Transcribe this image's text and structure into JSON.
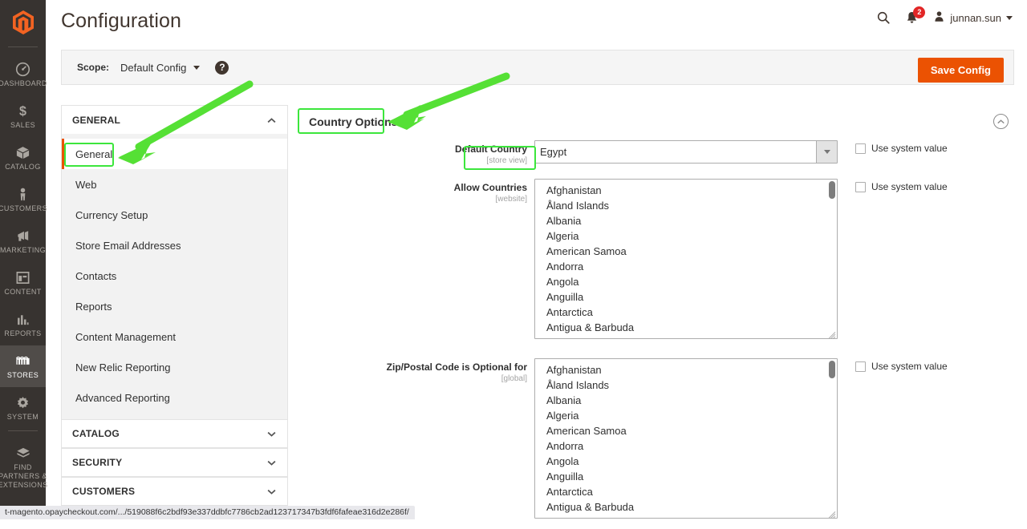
{
  "app": {
    "page_title": "Configuration",
    "logo_icon": "magento-logo-icon"
  },
  "rail": {
    "items": [
      {
        "label": "DASHBOARD",
        "icon": "dashboard-icon",
        "active": false
      },
      {
        "label": "SALES",
        "icon": "dollar-icon",
        "active": false
      },
      {
        "label": "CATALOG",
        "icon": "box-icon",
        "active": false
      },
      {
        "label": "CUSTOMERS",
        "icon": "person-icon",
        "active": false
      },
      {
        "label": "MARKETING",
        "icon": "megaphone-icon",
        "active": false
      },
      {
        "label": "CONTENT",
        "icon": "layout-icon",
        "active": false
      },
      {
        "label": "REPORTS",
        "icon": "bar-chart-icon",
        "active": false
      },
      {
        "label": "STORES",
        "icon": "storefront-icon",
        "active": true
      },
      {
        "label": "SYSTEM",
        "icon": "gear-icon",
        "active": false
      },
      {
        "label": "FIND PARTNERS & EXTENSIONS",
        "icon": "package-icon",
        "active": false
      }
    ]
  },
  "header": {
    "search_icon": "search-icon",
    "notifications_icon": "bell-icon",
    "notifications_count": "2",
    "user_name": "junnan.sun",
    "user_icon": "user-avatar-icon"
  },
  "scope_bar": {
    "label": "Scope:",
    "selected": "Default Config",
    "help_icon": "question-mark-icon",
    "save_label": "Save Config"
  },
  "config_nav": {
    "sections": [
      {
        "name": "GENERAL",
        "expanded": true,
        "chevron": "chevron-up-icon"
      },
      {
        "name": "CATALOG",
        "expanded": false,
        "chevron": "chevron-down-icon"
      },
      {
        "name": "SECURITY",
        "expanded": false,
        "chevron": "chevron-down-icon"
      },
      {
        "name": "CUSTOMERS",
        "expanded": false,
        "chevron": "chevron-down-icon"
      }
    ],
    "general_items": [
      {
        "label": "General",
        "current": true
      },
      {
        "label": "Web",
        "current": false
      },
      {
        "label": "Currency Setup",
        "current": false
      },
      {
        "label": "Store Email Addresses",
        "current": false
      },
      {
        "label": "Contacts",
        "current": false
      },
      {
        "label": "Reports",
        "current": false
      },
      {
        "label": "Content Management",
        "current": false
      },
      {
        "label": "New Relic Reporting",
        "current": false
      },
      {
        "label": "Advanced Reporting",
        "current": false
      }
    ]
  },
  "content": {
    "section_title": "Country Options",
    "collapse_icon": "chevron-up-circle-icon",
    "fields": [
      {
        "label": "Default Country",
        "scope": "[store view]",
        "type": "select",
        "value": "Egypt",
        "use_system_value_label": "Use system value",
        "use_system_value_checked": false
      },
      {
        "label": "Allow Countries",
        "scope": "[website]",
        "type": "multiselect",
        "options": [
          "Afghanistan",
          "Åland Islands",
          "Albania",
          "Algeria",
          "American Samoa",
          "Andorra",
          "Angola",
          "Anguilla",
          "Antarctica",
          "Antigua & Barbuda"
        ],
        "use_system_value_label": "Use system value",
        "use_system_value_checked": false
      },
      {
        "label": "Zip/Postal Code is Optional for",
        "scope": "[global]",
        "type": "multiselect",
        "options": [
          "Afghanistan",
          "Åland Islands",
          "Albania",
          "Algeria",
          "American Samoa",
          "Andorra",
          "Angola",
          "Anguilla",
          "Antarctica",
          "Antigua & Barbuda"
        ],
        "use_system_value_label": "Use system value",
        "use_system_value_checked": false
      }
    ]
  },
  "annotations": {
    "accent_color": "#3ce63c",
    "boxes": [
      {
        "name": "general-nav-item-highlight"
      },
      {
        "name": "country-options-title-highlight"
      },
      {
        "name": "default-country-label-highlight"
      }
    ],
    "arrows": [
      {
        "name": "arrow-to-general-nav-item"
      },
      {
        "name": "arrow-to-country-options-title"
      }
    ]
  },
  "status_bar": {
    "url": "t-magento.opaycheckout.com/.../519088f6c2bdf93e337ddbfc7786cb2ad123717347b3fdf6fafeae316d2e286f/"
  }
}
